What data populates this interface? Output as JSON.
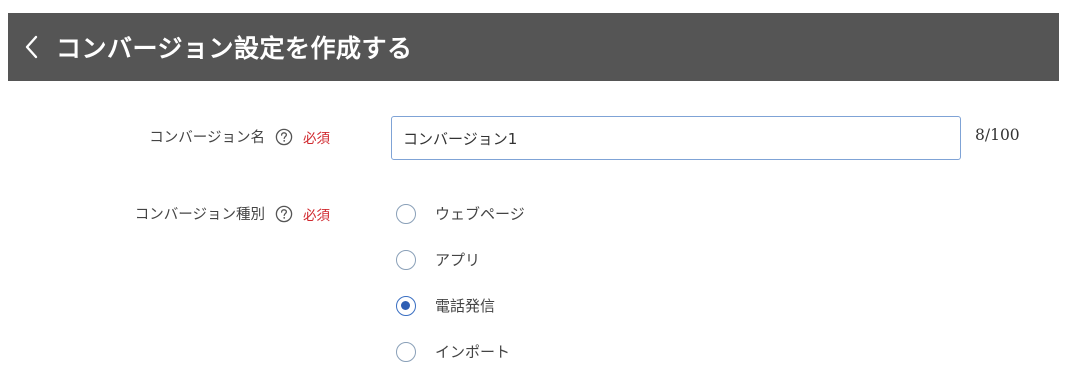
{
  "header": {
    "title": "コンバージョン設定を作成する",
    "back_icon": "chevron-left-icon"
  },
  "form": {
    "name_field": {
      "label": "コンバージョン名",
      "required_label": "必須",
      "value": "コンバージョン1",
      "counter": "8/100"
    },
    "type_field": {
      "label": "コンバージョン種別",
      "required_label": "必須",
      "options": [
        {
          "label": "ウェブページ",
          "checked": false
        },
        {
          "label": "アプリ",
          "checked": false
        },
        {
          "label": "電話発信",
          "checked": true
        },
        {
          "label": "インポート",
          "checked": false
        }
      ]
    }
  },
  "colors": {
    "header_bg": "#555555",
    "required": "#d0282e",
    "input_border": "#7fa3d6",
    "radio_checked": "#2f5fb4"
  }
}
